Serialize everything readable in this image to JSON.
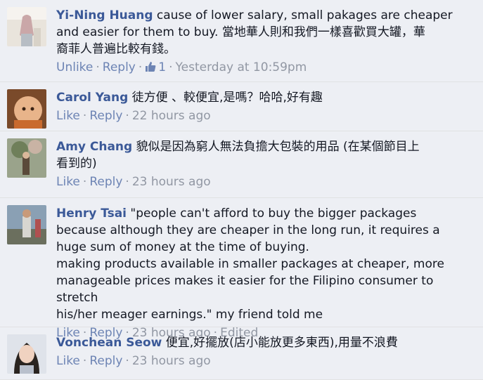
{
  "comments": [
    {
      "author": "Yi-Ning Huang",
      "text": "cause of lower salary, small pakages are cheaper\nand easier for them to buy. 當地華人則和我們一樣喜歡買大罐，華\n裔菲人普遍比較有錢。",
      "actions": {
        "like": "Unlike",
        "reply": "Reply"
      },
      "like_count": "1",
      "time": "Yesterday at 10:59pm"
    },
    {
      "author": "Carol Yang",
      "text": "徒方便 、較便宜,是嗎？哈哈,好有趣",
      "actions": {
        "like": "Like",
        "reply": "Reply"
      },
      "time": "22 hours ago"
    },
    {
      "author": "Amy Chang",
      "text": "貌似是因為窮人無法負擔大包裝的用品 (在某個節目上\n看到的)",
      "actions": {
        "like": "Like",
        "reply": "Reply"
      },
      "time": "23 hours ago"
    },
    {
      "author": "Henry Tsai",
      "text": "\"people can't afford to buy the bigger packages\nbecause although they are cheaper in the long run, it requires a\nhuge sum of money at the time of buying.\nmaking products available in smaller packages at cheaper, more\nmanageable prices makes it easier for the Filipino consumer to stretch\nhis/her meager earnings.\" my friend told me",
      "actions": {
        "like": "Like",
        "reply": "Reply"
      },
      "time": "23 hours ago",
      "edited": "Edited"
    },
    {
      "author": "Vonchean Seow",
      "text": "便宜,好擺放(店小能放更多東西),用量不浪費",
      "actions": {
        "like": "Like",
        "reply": "Reply"
      },
      "time": "23 hours ago"
    }
  ],
  "separator": "·",
  "colors": {
    "link": "#3b5998",
    "action": "#6d84b4",
    "meta": "#9197a3",
    "background": "#edeff4"
  }
}
